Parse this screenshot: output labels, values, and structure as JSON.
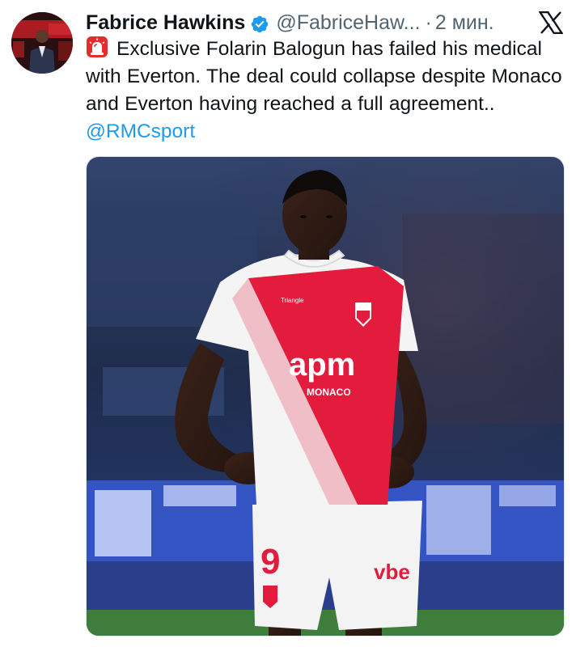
{
  "tweet": {
    "author": {
      "display_name": "Fabrice Hawkins",
      "handle": "@FabriceHaw...",
      "time": "2 мин.",
      "avatar_icon": "avatar-photo",
      "verified_icon": "verified-badge-icon"
    },
    "text": {
      "prefix_icon": "police-siren-icon",
      "body": "Exclusive Folarin Balogun has failed his medical with Everton. The deal could collapse despite Monaco and Everton having reached a full agreement..",
      "mention": "@RMCsport"
    },
    "platform_icon": "x-logo-icon",
    "media": {
      "kind": "photo",
      "jersey_sponsor": "apm",
      "jersey_club": "MONACO",
      "jersey_number": "9",
      "shorts_sponsor": "vbe",
      "kit_maker": "Triangle Intérim"
    }
  },
  "colors": {
    "accent_blue": "#1d9bf0",
    "verified_blue": "#1d9bf0",
    "text_primary": "#0f1419",
    "text_secondary": "#536471",
    "monaco_red": "#e31b3c"
  }
}
